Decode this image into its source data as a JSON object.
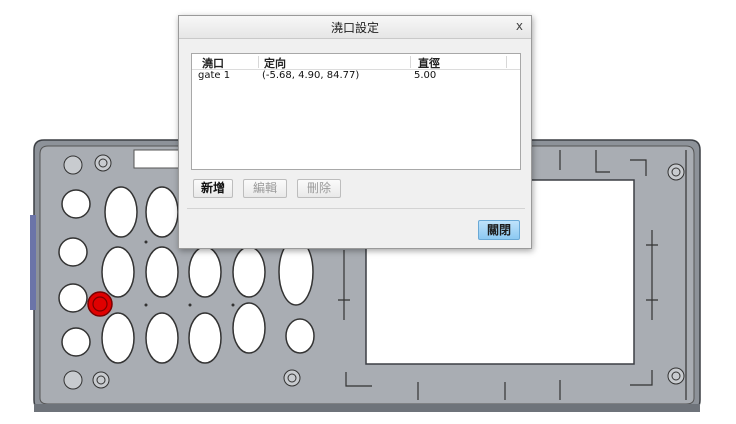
{
  "dialog": {
    "title": "澆口設定",
    "close_glyph": "x",
    "columns": [
      "澆口",
      "定向",
      "直徑"
    ],
    "rows": [
      {
        "name": "gate 1",
        "orientation": "(-5.68, 4.90, 84.77)",
        "diameter": "5.00"
      }
    ],
    "buttons": {
      "add": "新增",
      "edit": "編輯",
      "delete": "刪除"
    },
    "close_label": "關閉"
  },
  "colors": {
    "part_fill": "#8a8f96",
    "gate_marker": "#e00000",
    "accent_button": "#8cc9f2"
  },
  "icons": [
    "close-icon",
    "gate-marker-icon"
  ]
}
